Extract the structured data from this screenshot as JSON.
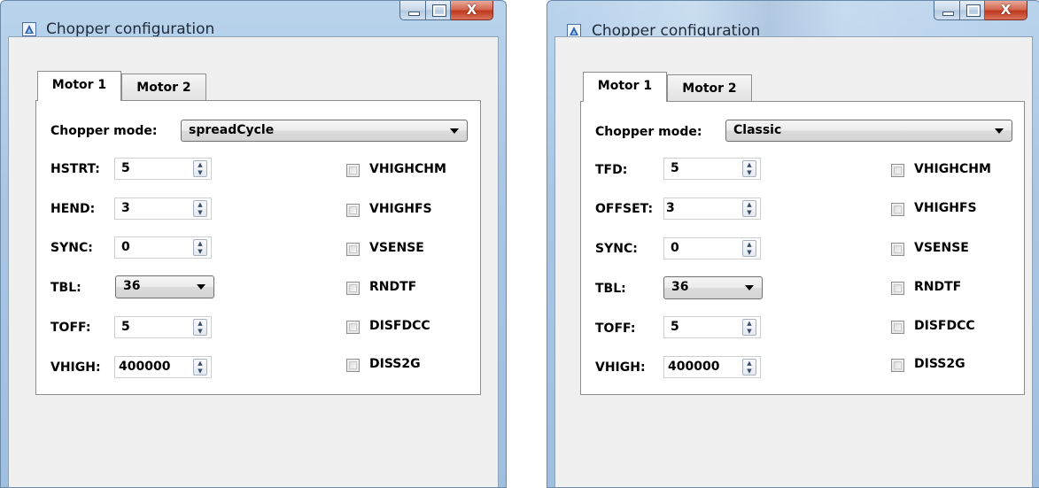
{
  "windows": [
    {
      "title": "Chopper configuration",
      "controls": {
        "minimize": "minimize-icon",
        "maximize": "maximize-icon",
        "close": "close-icon",
        "close_glyph": "X"
      },
      "tabs": [
        {
          "label": "Motor 1",
          "selected": true
        },
        {
          "label": "Motor 2",
          "selected": false
        }
      ],
      "chopper_mode": {
        "label": "Chopper mode:",
        "value": "spreadCycle"
      },
      "fields": [
        {
          "label": "HSTRT:",
          "value": "5"
        },
        {
          "label": "HEND:",
          "value": "3"
        },
        {
          "label": "SYNC:",
          "value": "0"
        },
        {
          "label": "TBL:",
          "value": "36"
        },
        {
          "label": "TOFF:",
          "value": "5"
        },
        {
          "label": "VHIGH:",
          "value": "400000"
        }
      ],
      "checkboxes": [
        {
          "label": "VHIGHCHM",
          "checked": false
        },
        {
          "label": "VHIGHFS",
          "checked": false
        },
        {
          "label": "VSENSE",
          "checked": false
        },
        {
          "label": "RNDTF",
          "checked": false
        },
        {
          "label": "DISFDCC",
          "checked": false
        },
        {
          "label": "DISS2G",
          "checked": false
        }
      ]
    },
    {
      "title": "Chopper configuration",
      "controls": {
        "minimize": "minimize-icon",
        "maximize": "maximize-icon",
        "close": "close-icon",
        "close_glyph": "X"
      },
      "tabs": [
        {
          "label": "Motor 1",
          "selected": true
        },
        {
          "label": "Motor 2",
          "selected": false
        }
      ],
      "chopper_mode": {
        "label": "Chopper mode:",
        "value": "Classic"
      },
      "fields": [
        {
          "label": "TFD:",
          "value": "5"
        },
        {
          "label": "OFFSET:",
          "value": "3"
        },
        {
          "label": "SYNC:",
          "value": "0"
        },
        {
          "label": "TBL:",
          "value": "36"
        },
        {
          "label": "TOFF:",
          "value": "5"
        },
        {
          "label": "VHIGH:",
          "value": "400000"
        }
      ],
      "checkboxes": [
        {
          "label": "VHIGHCHM",
          "checked": false
        },
        {
          "label": "VHIGHFS",
          "checked": false
        },
        {
          "label": "VSENSE",
          "checked": false
        },
        {
          "label": "RNDTF",
          "checked": false
        },
        {
          "label": "DISFDCC",
          "checked": false
        },
        {
          "label": "DISS2G",
          "checked": false
        }
      ]
    }
  ],
  "colors": {
    "titlebar": "#a9c6e4",
    "close_button": "#c0391e",
    "client_bg": "#f0f0f0",
    "panel_bg": "#ffffff"
  }
}
